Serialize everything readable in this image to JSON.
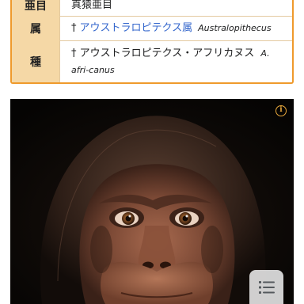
{
  "taxobox": {
    "rows": [
      {
        "rank": "亜目",
        "value": "真猿亜目"
      },
      {
        "rank": "属",
        "dagger": "†",
        "value": "アウストラロピテクス属",
        "latin": "Australopithecus"
      },
      {
        "rank": "種",
        "dagger": "†",
        "value": "アウストラロピテクス・アフリカヌス",
        "latin": "A. afri-canus"
      }
    ]
  },
  "image": {
    "info_icon": "info-icon",
    "toc_icon": "list-icon"
  },
  "colors": {
    "border": "#ef9a2c",
    "rank_bg": "#f5d8a6",
    "link": "#3366cc",
    "photo_bg": "#0a0807"
  }
}
